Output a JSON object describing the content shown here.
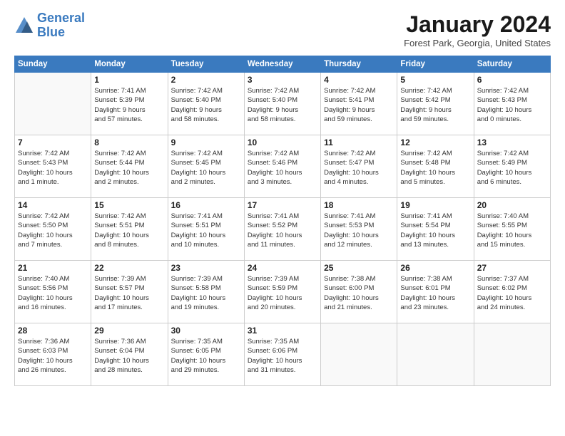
{
  "logo": {
    "line1": "General",
    "line2": "Blue"
  },
  "title": "January 2024",
  "location": "Forest Park, Georgia, United States",
  "days_of_week": [
    "Sunday",
    "Monday",
    "Tuesday",
    "Wednesday",
    "Thursday",
    "Friday",
    "Saturday"
  ],
  "weeks": [
    [
      {
        "day": "",
        "info": ""
      },
      {
        "day": "1",
        "info": "Sunrise: 7:41 AM\nSunset: 5:39 PM\nDaylight: 9 hours\nand 57 minutes."
      },
      {
        "day": "2",
        "info": "Sunrise: 7:42 AM\nSunset: 5:40 PM\nDaylight: 9 hours\nand 58 minutes."
      },
      {
        "day": "3",
        "info": "Sunrise: 7:42 AM\nSunset: 5:40 PM\nDaylight: 9 hours\nand 58 minutes."
      },
      {
        "day": "4",
        "info": "Sunrise: 7:42 AM\nSunset: 5:41 PM\nDaylight: 9 hours\nand 59 minutes."
      },
      {
        "day": "5",
        "info": "Sunrise: 7:42 AM\nSunset: 5:42 PM\nDaylight: 9 hours\nand 59 minutes."
      },
      {
        "day": "6",
        "info": "Sunrise: 7:42 AM\nSunset: 5:43 PM\nDaylight: 10 hours\nand 0 minutes."
      }
    ],
    [
      {
        "day": "7",
        "info": "Sunrise: 7:42 AM\nSunset: 5:43 PM\nDaylight: 10 hours\nand 1 minute."
      },
      {
        "day": "8",
        "info": "Sunrise: 7:42 AM\nSunset: 5:44 PM\nDaylight: 10 hours\nand 2 minutes."
      },
      {
        "day": "9",
        "info": "Sunrise: 7:42 AM\nSunset: 5:45 PM\nDaylight: 10 hours\nand 2 minutes."
      },
      {
        "day": "10",
        "info": "Sunrise: 7:42 AM\nSunset: 5:46 PM\nDaylight: 10 hours\nand 3 minutes."
      },
      {
        "day": "11",
        "info": "Sunrise: 7:42 AM\nSunset: 5:47 PM\nDaylight: 10 hours\nand 4 minutes."
      },
      {
        "day": "12",
        "info": "Sunrise: 7:42 AM\nSunset: 5:48 PM\nDaylight: 10 hours\nand 5 minutes."
      },
      {
        "day": "13",
        "info": "Sunrise: 7:42 AM\nSunset: 5:49 PM\nDaylight: 10 hours\nand 6 minutes."
      }
    ],
    [
      {
        "day": "14",
        "info": "Sunrise: 7:42 AM\nSunset: 5:50 PM\nDaylight: 10 hours\nand 7 minutes."
      },
      {
        "day": "15",
        "info": "Sunrise: 7:42 AM\nSunset: 5:51 PM\nDaylight: 10 hours\nand 8 minutes."
      },
      {
        "day": "16",
        "info": "Sunrise: 7:41 AM\nSunset: 5:51 PM\nDaylight: 10 hours\nand 10 minutes."
      },
      {
        "day": "17",
        "info": "Sunrise: 7:41 AM\nSunset: 5:52 PM\nDaylight: 10 hours\nand 11 minutes."
      },
      {
        "day": "18",
        "info": "Sunrise: 7:41 AM\nSunset: 5:53 PM\nDaylight: 10 hours\nand 12 minutes."
      },
      {
        "day": "19",
        "info": "Sunrise: 7:41 AM\nSunset: 5:54 PM\nDaylight: 10 hours\nand 13 minutes."
      },
      {
        "day": "20",
        "info": "Sunrise: 7:40 AM\nSunset: 5:55 PM\nDaylight: 10 hours\nand 15 minutes."
      }
    ],
    [
      {
        "day": "21",
        "info": "Sunrise: 7:40 AM\nSunset: 5:56 PM\nDaylight: 10 hours\nand 16 minutes."
      },
      {
        "day": "22",
        "info": "Sunrise: 7:39 AM\nSunset: 5:57 PM\nDaylight: 10 hours\nand 17 minutes."
      },
      {
        "day": "23",
        "info": "Sunrise: 7:39 AM\nSunset: 5:58 PM\nDaylight: 10 hours\nand 19 minutes."
      },
      {
        "day": "24",
        "info": "Sunrise: 7:39 AM\nSunset: 5:59 PM\nDaylight: 10 hours\nand 20 minutes."
      },
      {
        "day": "25",
        "info": "Sunrise: 7:38 AM\nSunset: 6:00 PM\nDaylight: 10 hours\nand 21 minutes."
      },
      {
        "day": "26",
        "info": "Sunrise: 7:38 AM\nSunset: 6:01 PM\nDaylight: 10 hours\nand 23 minutes."
      },
      {
        "day": "27",
        "info": "Sunrise: 7:37 AM\nSunset: 6:02 PM\nDaylight: 10 hours\nand 24 minutes."
      }
    ],
    [
      {
        "day": "28",
        "info": "Sunrise: 7:36 AM\nSunset: 6:03 PM\nDaylight: 10 hours\nand 26 minutes."
      },
      {
        "day": "29",
        "info": "Sunrise: 7:36 AM\nSunset: 6:04 PM\nDaylight: 10 hours\nand 28 minutes."
      },
      {
        "day": "30",
        "info": "Sunrise: 7:35 AM\nSunset: 6:05 PM\nDaylight: 10 hours\nand 29 minutes."
      },
      {
        "day": "31",
        "info": "Sunrise: 7:35 AM\nSunset: 6:06 PM\nDaylight: 10 hours\nand 31 minutes."
      },
      {
        "day": "",
        "info": ""
      },
      {
        "day": "",
        "info": ""
      },
      {
        "day": "",
        "info": ""
      }
    ]
  ]
}
